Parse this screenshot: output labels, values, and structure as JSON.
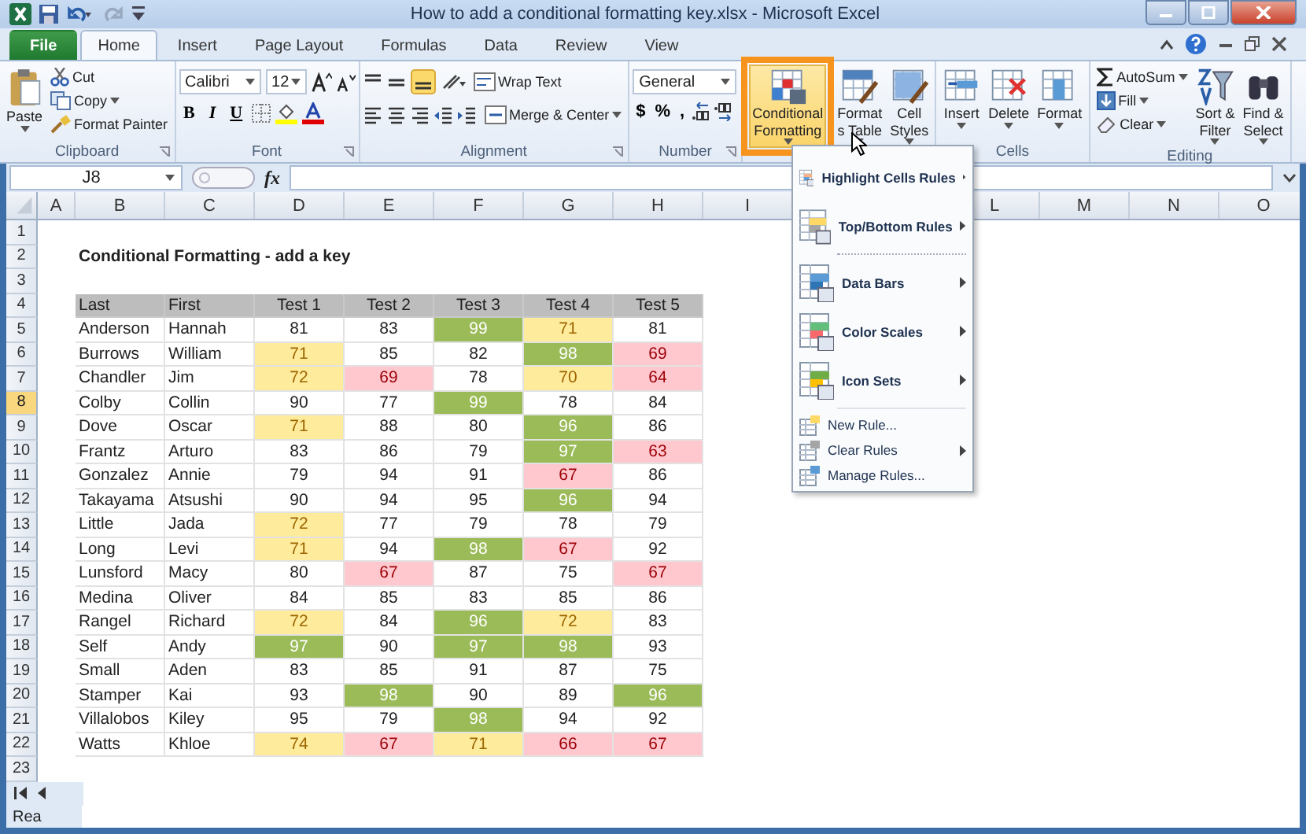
{
  "window": {
    "title": "How to add a conditional formatting key.xlsx - Microsoft Excel"
  },
  "tabs": [
    {
      "label": "File",
      "kind": "file",
      "selected": false
    },
    {
      "label": "Home",
      "kind": "tab",
      "selected": true
    },
    {
      "label": "Insert",
      "kind": "tab",
      "selected": false
    },
    {
      "label": "Page Layout",
      "kind": "tab",
      "selected": false
    },
    {
      "label": "Formulas",
      "kind": "tab",
      "selected": false
    },
    {
      "label": "Data",
      "kind": "tab",
      "selected": false
    },
    {
      "label": "Review",
      "kind": "tab",
      "selected": false
    },
    {
      "label": "View",
      "kind": "tab",
      "selected": false
    }
  ],
  "ribbon": [
    {
      "kind": "clipboard",
      "label": "Clipboard",
      "paste": "Paste",
      "items": [
        "Cut",
        "Copy",
        "Format Painter"
      ]
    },
    {
      "kind": "font",
      "label": "Font",
      "font": "Calibri",
      "size": "12",
      "styles": [
        "B",
        "I",
        "U"
      ]
    },
    {
      "kind": "alignment",
      "label": "Alignment",
      "items": [
        "Wrap Text",
        "Merge & Center"
      ]
    },
    {
      "kind": "number",
      "label": "Number",
      "format": "General",
      "symbols": [
        "$",
        "%",
        ","
      ]
    },
    {
      "kind": "styles",
      "buttons": [
        {
          "lines": [
            "Conditional",
            "Formatting"
          ],
          "highlighted": true
        },
        {
          "lines": [
            "Format",
            "s Table"
          ],
          "highlighted": false
        },
        {
          "lines": [
            "Cell",
            "Styles"
          ],
          "highlighted": false
        }
      ]
    },
    {
      "kind": "cells",
      "label": "Cells",
      "buttons": [
        {
          "lines": [
            "Insert"
          ]
        },
        {
          "lines": [
            "Delete"
          ]
        },
        {
          "lines": [
            "Format"
          ]
        }
      ]
    },
    {
      "kind": "editing",
      "label": "Editing",
      "items": [
        "AutoSum",
        "Fill",
        "Clear"
      ],
      "buttons": [
        {
          "lines": [
            "Sort &",
            "Filter"
          ]
        },
        {
          "lines": [
            "Find &",
            "Select"
          ]
        }
      ]
    }
  ],
  "formula_bar": {
    "name_box": "J8",
    "function_label": "fx"
  },
  "sheet": {
    "columns_left": [
      "A",
      "B",
      "C",
      "D",
      "E",
      "F",
      "G",
      "H",
      "I"
    ],
    "columns_right": [
      "L",
      "M",
      "N",
      "O"
    ],
    "row_headers": [
      {
        "label": "1",
        "selected": false
      },
      {
        "label": "2",
        "selected": false
      },
      {
        "label": "3",
        "selected": false
      },
      {
        "label": "4",
        "selected": false
      },
      {
        "label": "5",
        "selected": false
      },
      {
        "label": "6",
        "selected": false
      },
      {
        "label": "7",
        "selected": false
      },
      {
        "label": "8",
        "selected": true
      },
      {
        "label": "9",
        "selected": false
      },
      {
        "label": "10",
        "selected": false
      },
      {
        "label": "11",
        "selected": false
      },
      {
        "label": "12",
        "selected": false
      },
      {
        "label": "13",
        "selected": false
      },
      {
        "label": "14",
        "selected": false
      },
      {
        "label": "15",
        "selected": false
      },
      {
        "label": "16",
        "selected": false
      },
      {
        "label": "17",
        "selected": false
      },
      {
        "label": "18",
        "selected": false
      },
      {
        "label": "19",
        "selected": false
      },
      {
        "label": "20",
        "selected": false
      },
      {
        "label": "21",
        "selected": false
      },
      {
        "label": "22",
        "selected": false
      },
      {
        "label": "23",
        "selected": false
      }
    ],
    "title": "Conditional Formatting - add a key",
    "table": {
      "columns": [
        "Last",
        "First",
        "Test 1",
        "Test 2",
        "Test 3",
        "Test 4",
        "Test 5"
      ],
      "rows": [
        {
          "last": "Anderson",
          "first": "Hannah",
          "scores": [
            {
              "value": "81",
              "kind": "plain"
            },
            {
              "value": "83",
              "kind": "plain"
            },
            {
              "value": "99",
              "kind": "top"
            },
            {
              "value": "71",
              "kind": "mid"
            },
            {
              "value": "81",
              "kind": "plain"
            }
          ]
        },
        {
          "last": "Burrows",
          "first": "William",
          "scores": [
            {
              "value": "71",
              "kind": "mid"
            },
            {
              "value": "85",
              "kind": "plain"
            },
            {
              "value": "82",
              "kind": "plain"
            },
            {
              "value": "98",
              "kind": "top"
            },
            {
              "value": "69",
              "kind": "low"
            }
          ]
        },
        {
          "last": "Chandler",
          "first": "Jim",
          "scores": [
            {
              "value": "72",
              "kind": "mid"
            },
            {
              "value": "69",
              "kind": "low"
            },
            {
              "value": "78",
              "kind": "plain"
            },
            {
              "value": "70",
              "kind": "mid"
            },
            {
              "value": "64",
              "kind": "low"
            }
          ]
        },
        {
          "last": "Colby",
          "first": "Collin",
          "scores": [
            {
              "value": "90",
              "kind": "plain"
            },
            {
              "value": "77",
              "kind": "plain"
            },
            {
              "value": "99",
              "kind": "top"
            },
            {
              "value": "78",
              "kind": "plain"
            },
            {
              "value": "84",
              "kind": "plain"
            }
          ]
        },
        {
          "last": "Dove",
          "first": "Oscar",
          "scores": [
            {
              "value": "71",
              "kind": "mid"
            },
            {
              "value": "88",
              "kind": "plain"
            },
            {
              "value": "80",
              "kind": "plain"
            },
            {
              "value": "96",
              "kind": "top"
            },
            {
              "value": "86",
              "kind": "plain"
            }
          ]
        },
        {
          "last": "Frantz",
          "first": "Arturo",
          "scores": [
            {
              "value": "83",
              "kind": "plain"
            },
            {
              "value": "86",
              "kind": "plain"
            },
            {
              "value": "79",
              "kind": "plain"
            },
            {
              "value": "97",
              "kind": "top"
            },
            {
              "value": "63",
              "kind": "low"
            }
          ]
        },
        {
          "last": "Gonzalez",
          "first": "Annie",
          "scores": [
            {
              "value": "79",
              "kind": "plain"
            },
            {
              "value": "94",
              "kind": "plain"
            },
            {
              "value": "91",
              "kind": "plain"
            },
            {
              "value": "67",
              "kind": "low"
            },
            {
              "value": "86",
              "kind": "plain"
            }
          ]
        },
        {
          "last": "Takayama",
          "first": "Atsushi",
          "scores": [
            {
              "value": "90",
              "kind": "plain"
            },
            {
              "value": "94",
              "kind": "plain"
            },
            {
              "value": "95",
              "kind": "plain"
            },
            {
              "value": "96",
              "kind": "top"
            },
            {
              "value": "94",
              "kind": "plain"
            }
          ]
        },
        {
          "last": "Little",
          "first": "Jada",
          "scores": [
            {
              "value": "72",
              "kind": "mid"
            },
            {
              "value": "77",
              "kind": "plain"
            },
            {
              "value": "79",
              "kind": "plain"
            },
            {
              "value": "78",
              "kind": "plain"
            },
            {
              "value": "79",
              "kind": "plain"
            }
          ]
        },
        {
          "last": "Long",
          "first": "Levi",
          "scores": [
            {
              "value": "71",
              "kind": "mid"
            },
            {
              "value": "94",
              "kind": "plain"
            },
            {
              "value": "98",
              "kind": "top"
            },
            {
              "value": "67",
              "kind": "low"
            },
            {
              "value": "92",
              "kind": "plain"
            }
          ]
        },
        {
          "last": "Lunsford",
          "first": "Macy",
          "scores": [
            {
              "value": "80",
              "kind": "plain"
            },
            {
              "value": "67",
              "kind": "low"
            },
            {
              "value": "87",
              "kind": "plain"
            },
            {
              "value": "75",
              "kind": "plain"
            },
            {
              "value": "67",
              "kind": "low"
            }
          ]
        },
        {
          "last": "Medina",
          "first": "Oliver",
          "scores": [
            {
              "value": "84",
              "kind": "plain"
            },
            {
              "value": "85",
              "kind": "plain"
            },
            {
              "value": "83",
              "kind": "plain"
            },
            {
              "value": "85",
              "kind": "plain"
            },
            {
              "value": "86",
              "kind": "plain"
            }
          ]
        },
        {
          "last": "Rangel",
          "first": "Richard",
          "scores": [
            {
              "value": "72",
              "kind": "mid"
            },
            {
              "value": "84",
              "kind": "plain"
            },
            {
              "value": "96",
              "kind": "top"
            },
            {
              "value": "72",
              "kind": "mid"
            },
            {
              "value": "83",
              "kind": "plain"
            }
          ]
        },
        {
          "last": "Self",
          "first": "Andy",
          "scores": [
            {
              "value": "97",
              "kind": "top"
            },
            {
              "value": "90",
              "kind": "plain"
            },
            {
              "value": "97",
              "kind": "top"
            },
            {
              "value": "98",
              "kind": "top"
            },
            {
              "value": "93",
              "kind": "plain"
            }
          ]
        },
        {
          "last": "Small",
          "first": "Aden",
          "scores": [
            {
              "value": "83",
              "kind": "plain"
            },
            {
              "value": "85",
              "kind": "plain"
            },
            {
              "value": "91",
              "kind": "plain"
            },
            {
              "value": "87",
              "kind": "plain"
            },
            {
              "value": "75",
              "kind": "plain"
            }
          ]
        },
        {
          "last": "Stamper",
          "first": "Kai",
          "scores": [
            {
              "value": "93",
              "kind": "plain"
            },
            {
              "value": "98",
              "kind": "top"
            },
            {
              "value": "90",
              "kind": "plain"
            },
            {
              "value": "89",
              "kind": "plain"
            },
            {
              "value": "96",
              "kind": "top"
            }
          ]
        },
        {
          "last": "Villalobos",
          "first": "Kiley",
          "scores": [
            {
              "value": "95",
              "kind": "plain"
            },
            {
              "value": "79",
              "kind": "plain"
            },
            {
              "value": "98",
              "kind": "top"
            },
            {
              "value": "94",
              "kind": "plain"
            },
            {
              "value": "92",
              "kind": "plain"
            }
          ]
        },
        {
          "last": "Watts",
          "first": "Khloe",
          "scores": [
            {
              "value": "74",
              "kind": "mid"
            },
            {
              "value": "67",
              "kind": "low"
            },
            {
              "value": "71",
              "kind": "mid"
            },
            {
              "value": "66",
              "kind": "low"
            },
            {
              "value": "67",
              "kind": "low"
            }
          ]
        }
      ]
    }
  },
  "menu": {
    "groups": [
      [
        {
          "label": "Highlight Cells Rules",
          "kind": "large",
          "submenu": true
        },
        {
          "label": "Top/Bottom Rules",
          "kind": "large",
          "submenu": true
        }
      ],
      [
        {
          "label": "Data Bars",
          "kind": "large",
          "submenu": true
        },
        {
          "label": "Color Scales",
          "kind": "large",
          "submenu": true
        },
        {
          "label": "Icon Sets",
          "kind": "large",
          "submenu": true
        }
      ],
      [
        {
          "label": "New Rule...",
          "kind": "small",
          "submenu": false
        },
        {
          "label": "Clear Rules",
          "kind": "small",
          "submenu": true
        },
        {
          "label": "Manage Rules...",
          "kind": "small",
          "submenu": false
        }
      ]
    ]
  },
  "status_bar": {
    "text": "Rea"
  }
}
